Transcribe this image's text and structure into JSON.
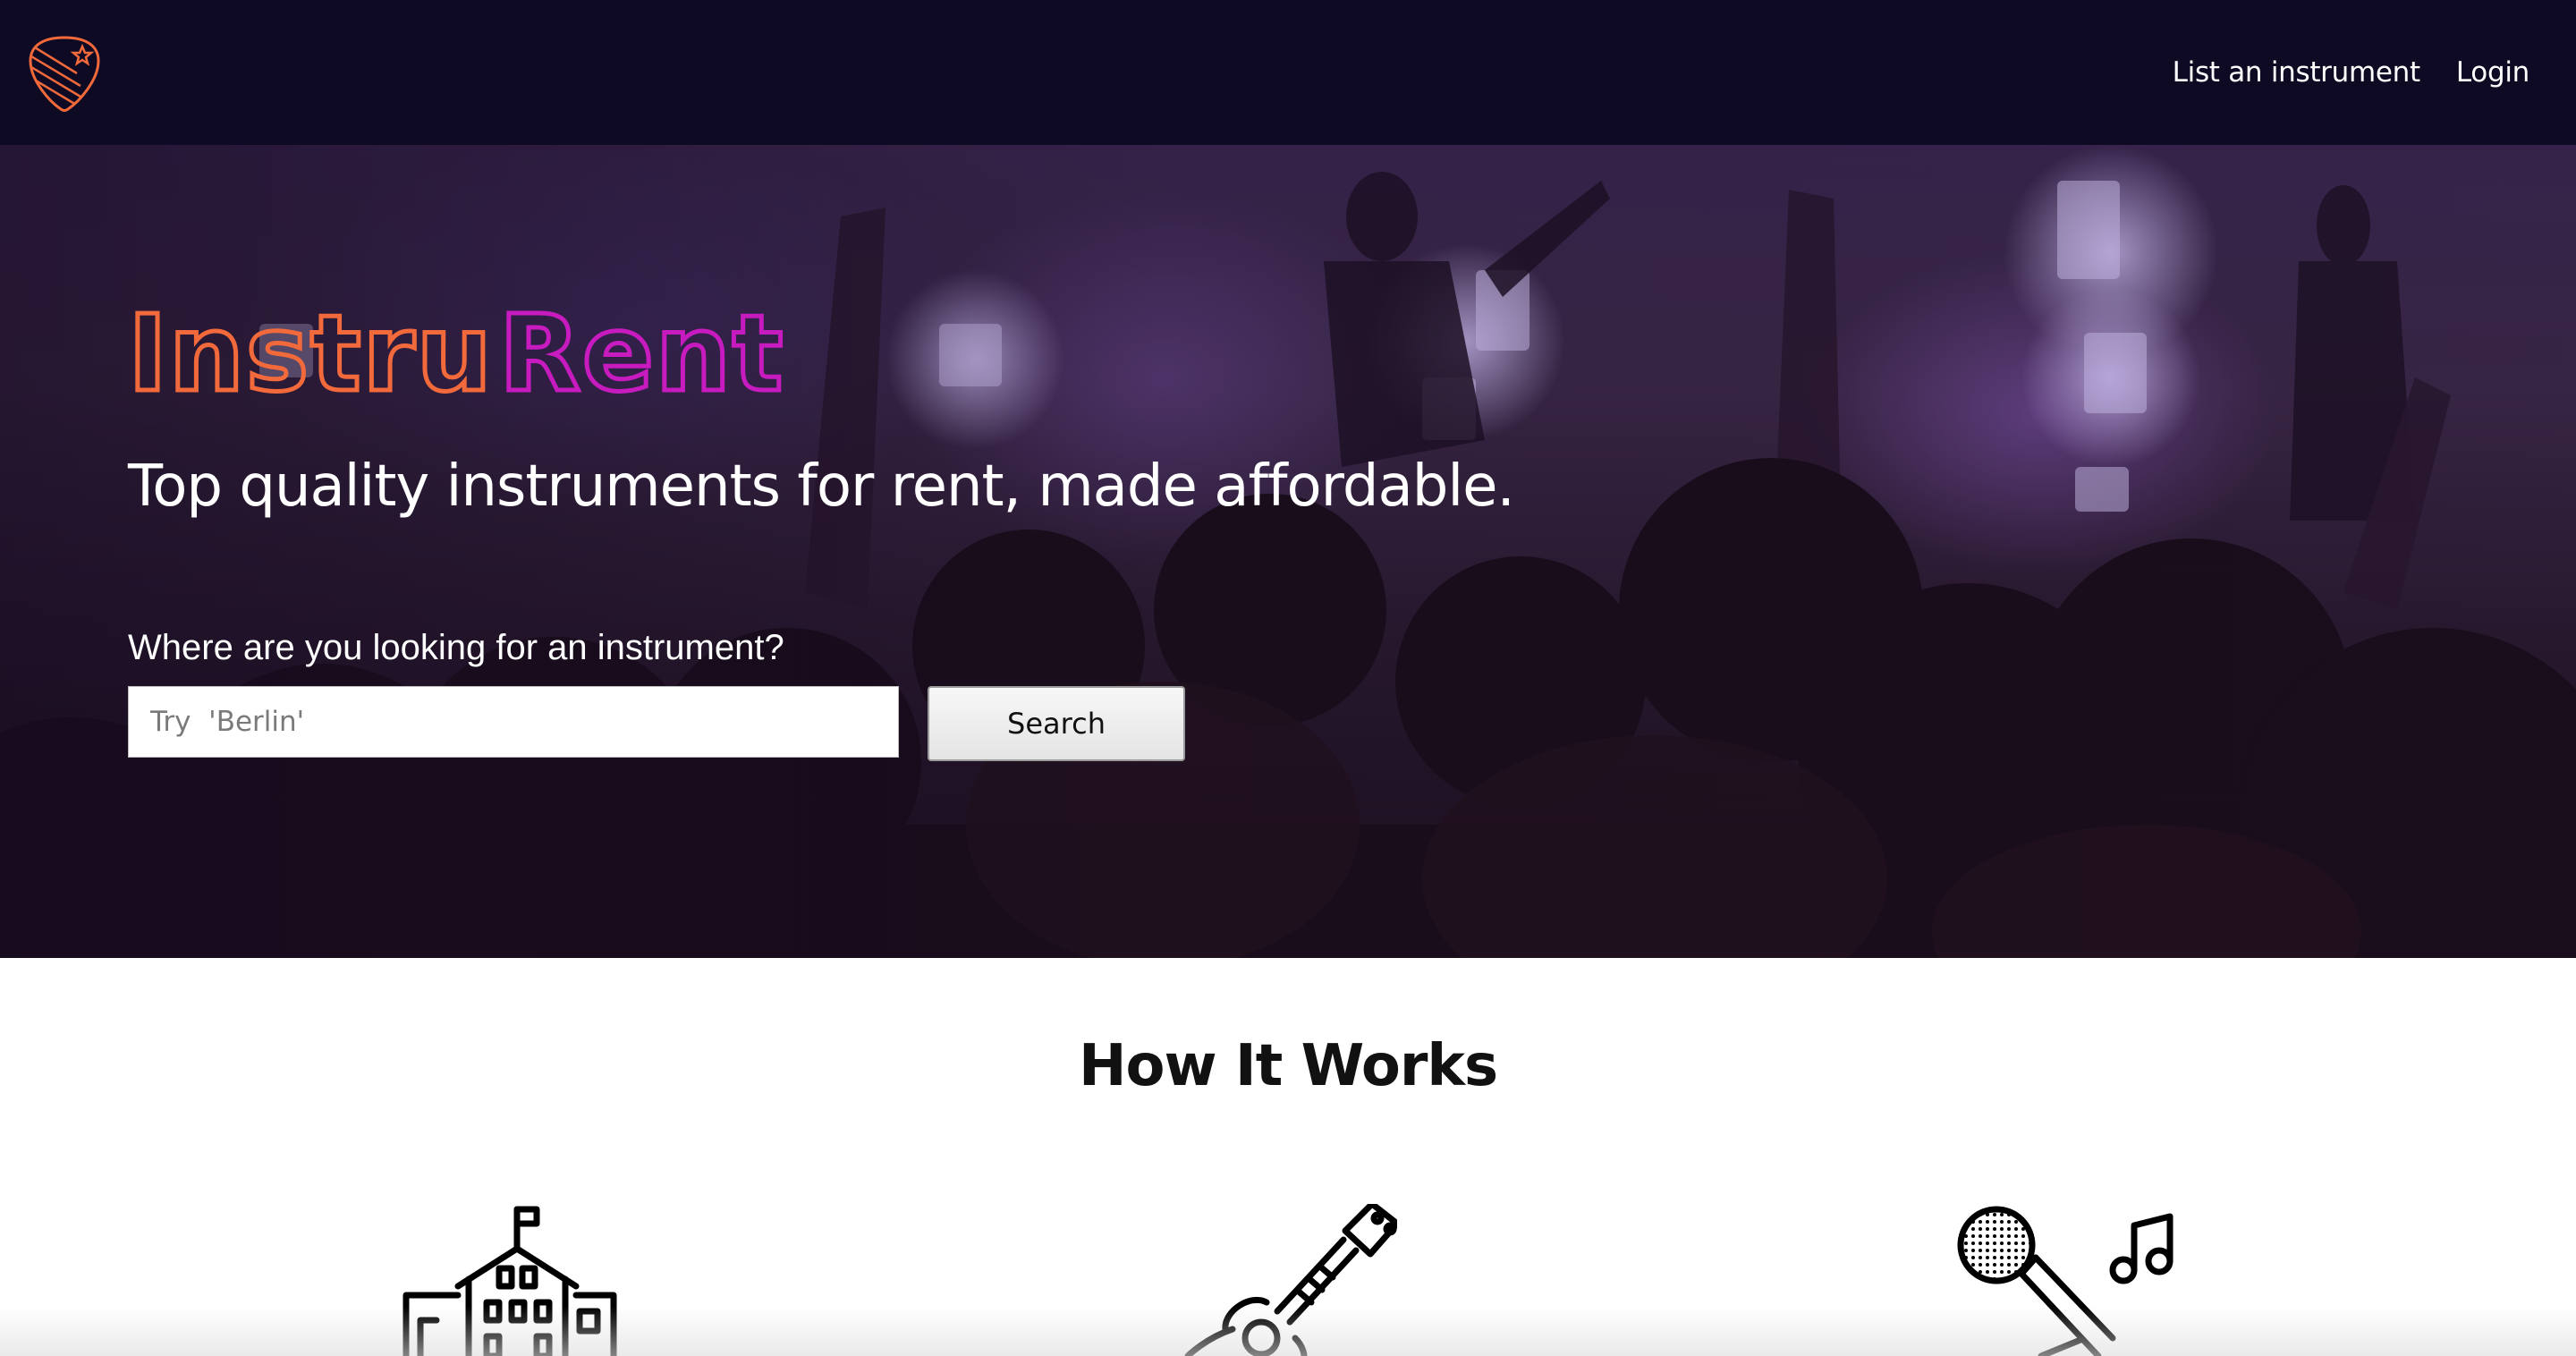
{
  "navbar": {
    "logo_icon": "guitar-pick-icon",
    "links": [
      "List an instrument",
      "Login"
    ]
  },
  "hero": {
    "brand_part1": "Instru",
    "brand_part2": "Rent",
    "brand_color_start": "#f26a3c",
    "brand_color_end": "#c71bc0",
    "tagline": "Top quality instruments for rent, made affordable.",
    "search_label": "Where are you looking for an instrument?",
    "search_placeholder": "Try  'Berlin'",
    "search_button": "Search"
  },
  "how_it_works": {
    "title": "How It Works",
    "icons": [
      "building-icon",
      "guitar-icon",
      "microphone-music-icon"
    ]
  },
  "colors": {
    "navbar_bg": "#0e0a24",
    "accent_orange": "#f26a3c",
    "accent_magenta": "#c71bc0"
  }
}
